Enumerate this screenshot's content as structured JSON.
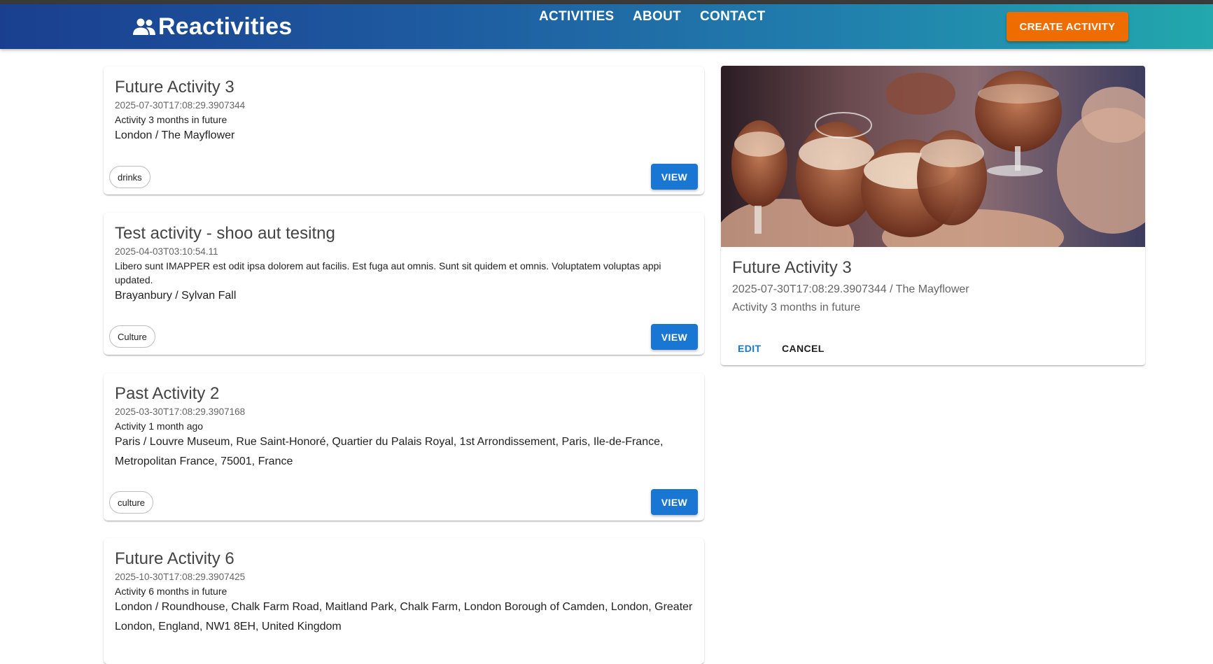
{
  "header": {
    "brand": "Reactivities",
    "nav": [
      "ACTIVITIES",
      "ABOUT",
      "CONTACT"
    ],
    "create_label": "CREATE ACTIVITY",
    "colors": {
      "appbar_start": "#1a3f8f",
      "appbar_end": "#22a8ad",
      "accent": "#ef6c00"
    }
  },
  "activities": [
    {
      "title": "Future Activity 3",
      "date": "2025-07-30T17:08:29.3907344",
      "description": "Activity 3 months in future",
      "venue": "London / The Mayflower",
      "category": "drinks",
      "view_label": "VIEW"
    },
    {
      "title": "Test activity - shoo aut tesitng",
      "date": "2025-04-03T03:10:54.11",
      "description": "Libero sunt IMAPPER est odit ipsa dolorem aut facilis. Est fuga aut omnis. Sunt sit quidem et omnis. Voluptatem voluptas appi updated.",
      "venue": "Brayanbury / Sylvan Fall",
      "category": "Culture",
      "view_label": "VIEW"
    },
    {
      "title": "Past Activity 2",
      "date": "2025-03-30T17:08:29.3907168",
      "description": "Activity 1 month ago",
      "venue": "Paris / Louvre Museum, Rue Saint-Honoré, Quartier du Palais Royal, 1st Arrondissement, Paris, Ile-de-France, Metropolitan France, 75001, France",
      "category": "culture",
      "view_label": "VIEW"
    },
    {
      "title": "Future Activity 6",
      "date": "2025-10-30T17:08:29.3907425",
      "description": "Activity 6 months in future",
      "venue": "London / Roundhouse, Chalk Farm Road, Maitland Park, Chalk Farm, London Borough of Camden, London, Greater London, England, NW1 8EH, United Kingdom"
    }
  ],
  "detail": {
    "title": "Future Activity 3",
    "subtitle": "2025-07-30T17:08:29.3907344 / The Mayflower",
    "description": "Activity 3 months in future",
    "edit_label": "EDIT",
    "cancel_label": "CANCEL"
  }
}
